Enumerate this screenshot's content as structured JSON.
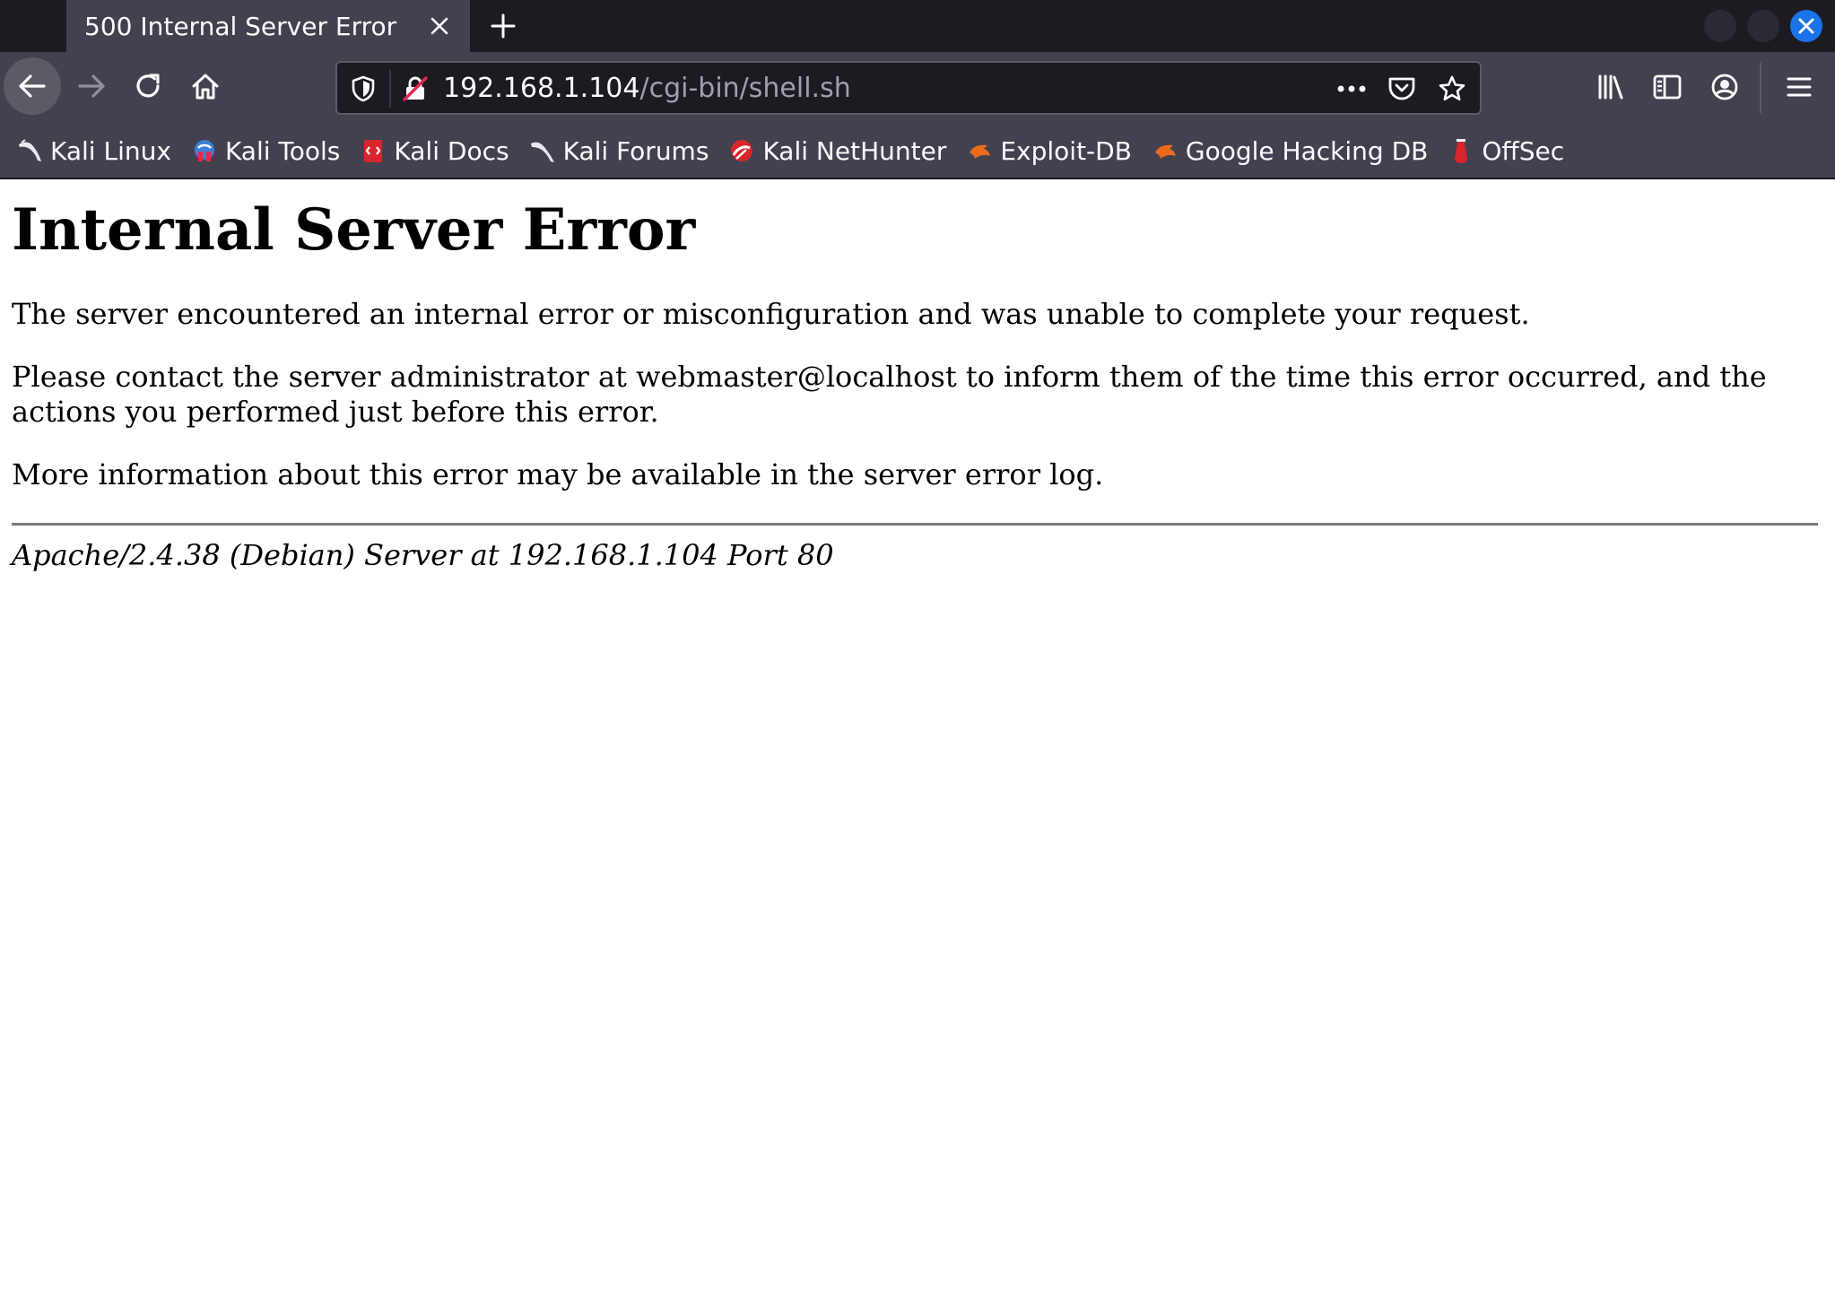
{
  "tab": {
    "title": "500 Internal Server Error"
  },
  "nav": {
    "url_host": "192.168.1.104",
    "url_path": "/cgi-bin/shell.sh"
  },
  "bookmarks": [
    {
      "label": "Kali Linux",
      "icon": "kali-dragon-icon"
    },
    {
      "label": "Kali Tools",
      "icon": "kali-tools-icon"
    },
    {
      "label": "Kali Docs",
      "icon": "kali-docs-icon"
    },
    {
      "label": "Kali Forums",
      "icon": "kali-forums-icon"
    },
    {
      "label": "Kali NetHunter",
      "icon": "nethunter-icon"
    },
    {
      "label": "Exploit-DB",
      "icon": "exploit-db-icon"
    },
    {
      "label": "Google Hacking DB",
      "icon": "ghdb-icon"
    },
    {
      "label": "OffSec",
      "icon": "offsec-icon"
    }
  ],
  "page": {
    "heading": "Internal Server Error",
    "p1": "The server encountered an internal error or misconfiguration and was unable to complete your request.",
    "p2": "Please contact the server administrator at webmaster@localhost to inform them of the time this error occurred, and the actions you performed just before this error.",
    "p3": "More information about this error may be available in the server error log.",
    "footer": "Apache/2.4.38 (Debian) Server at 192.168.1.104 Port 80"
  },
  "colors": {
    "chrome_dark": "#1c1b22",
    "chrome_mid": "#42414d",
    "accent_blue": "#1a73e8"
  }
}
